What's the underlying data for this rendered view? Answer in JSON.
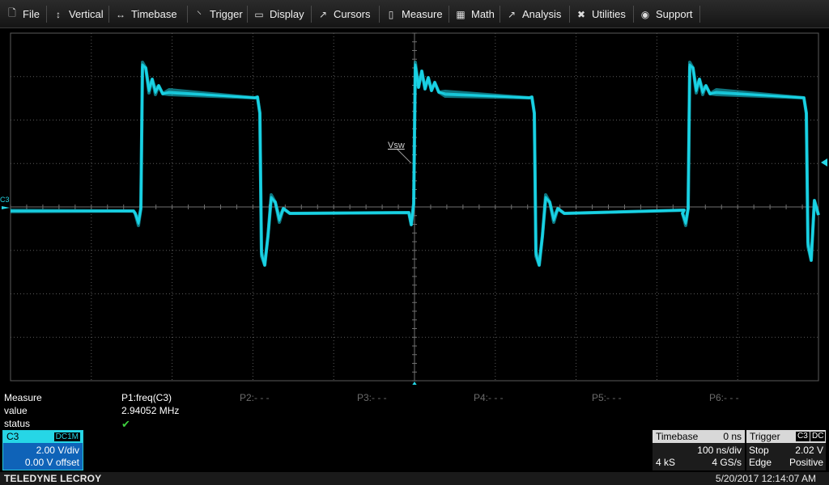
{
  "menu": {
    "file": "File",
    "vertical": "Vertical",
    "timebase": "Timebase",
    "trigger": "Trigger",
    "display": "Display",
    "cursors": "Cursors",
    "measure": "Measure",
    "math": "Math",
    "analysis": "Analysis",
    "utilities": "Utilities",
    "support": "Support"
  },
  "icons": {
    "file": "file-icon",
    "vertical": "vertical-arrows-icon",
    "timebase": "horizontal-arrows-icon",
    "trigger": "trigger-icon",
    "display": "display-icon",
    "cursors": "cursor-icon",
    "measure": "measure-icon",
    "math": "calculator-icon",
    "analysis": "analysis-icon",
    "utilities": "tools-icon",
    "support": "support-icon"
  },
  "waveform": {
    "channel_marker": "C3",
    "trace_label": "Vsw",
    "trace_color": "#19d3e6",
    "grid_color": "#5a5a5a"
  },
  "measure": {
    "label_measure": "Measure",
    "label_value": "value",
    "label_status": "status",
    "p1": "P1:freq(C3)",
    "p1_value": "2.94052 MHz",
    "p1_status": "✔",
    "p2": "P2:- - -",
    "p3": "P3:- - -",
    "p4": "P4:- - -",
    "p5": "P5:- - -",
    "p6": "P6:- - -"
  },
  "channel": {
    "name": "C3",
    "coupling": "DC1M",
    "vdiv": "2.00 V/div",
    "offset": "0.00 V offset",
    "color": "#26d6e6"
  },
  "timebase": {
    "title": "Timebase",
    "delay": "0 ns",
    "tdiv": "100 ns/div",
    "points": "4 kS",
    "rate": "4 GS/s"
  },
  "trigger": {
    "title": "Trigger",
    "source": "C3",
    "coupling": "DC",
    "mode": "Stop",
    "level": "2.02 V",
    "type": "Edge",
    "slope": "Positive"
  },
  "footer": {
    "brand": "TELEDYNE LECROY",
    "datetime": "5/20/2017 12:14:07 AM"
  }
}
